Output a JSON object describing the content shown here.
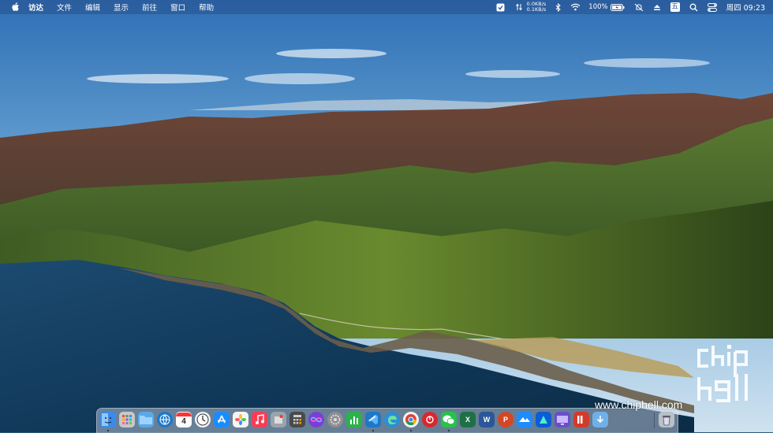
{
  "menubar": {
    "items": [
      "访达",
      "文件",
      "编辑",
      "显示",
      "前往",
      "窗口",
      "帮助"
    ],
    "net_up": "0.0KB/s",
    "net_down": "0.1KB/s",
    "battery": "100%",
    "ime": "五",
    "clock": "周四 09:23"
  },
  "dock": {
    "apps": [
      {
        "name": "Finder",
        "color": "#3b8bea"
      },
      {
        "name": "Launchpad",
        "color": "#c8c8c8"
      },
      {
        "name": "Folder",
        "color": "#5aa9e6"
      },
      {
        "name": "Browser",
        "color": "#1f78c8"
      },
      {
        "name": "Calendar",
        "color": "#ffffff",
        "text": "4"
      },
      {
        "name": "Clock",
        "color": "#f2f2f2"
      },
      {
        "name": "App Store",
        "color": "#1a8cff"
      },
      {
        "name": "Photos",
        "color": "#f5f5f5"
      },
      {
        "name": "Music",
        "color": "#fa3c55"
      },
      {
        "name": "Preview",
        "color": "#9aa4ad"
      },
      {
        "name": "Calculator",
        "color": "#4a4a4a"
      },
      {
        "name": "Siri",
        "color": "#7a3fd8"
      },
      {
        "name": "System Preferences",
        "color": "#8e8e93"
      },
      {
        "name": "Numbers",
        "color": "#2cb24b"
      },
      {
        "name": "VS Code",
        "color": "#1d78c6"
      },
      {
        "name": "Edge",
        "color": "#2a8fd6"
      },
      {
        "name": "Chrome",
        "color": "#f2f2f2"
      },
      {
        "name": "Netease Music",
        "color": "#d9272e"
      },
      {
        "name": "WeChat",
        "color": "#29c14a"
      },
      {
        "name": "Excel",
        "color": "#1e7145",
        "text": "X"
      },
      {
        "name": "Word",
        "color": "#2b579a",
        "text": "W"
      },
      {
        "name": "PowerPoint",
        "color": "#d24726",
        "text": "P"
      },
      {
        "name": "Lark",
        "color": "#1f8bff"
      },
      {
        "name": "Sourcetree",
        "color": "#0b5dd6"
      },
      {
        "name": "Monitor",
        "color": "#6a4fc8"
      },
      {
        "name": "Parallels",
        "color": "#d33a2c"
      },
      {
        "name": "Downloads",
        "color": "#6fb0e8"
      },
      {
        "name": "Trash",
        "color": "#b8c0c8"
      }
    ]
  },
  "watermark": {
    "url": "www.chiphell.com",
    "logo": "chip hell"
  }
}
